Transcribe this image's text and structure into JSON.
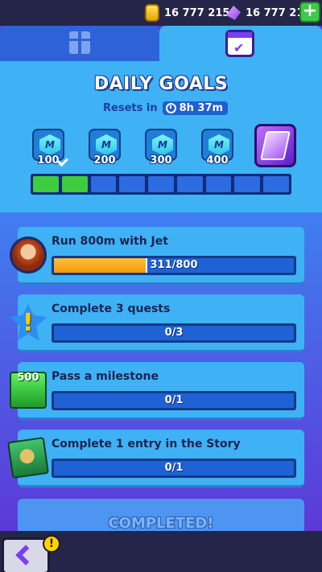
{
  "currency": {
    "coins": "16 777 215",
    "gems": "16 777 215",
    "add_label": "+"
  },
  "tabs": [
    {
      "name": "gifts",
      "icon": "gift-icon",
      "active": false
    },
    {
      "name": "daily-goals",
      "icon": "calendar-check-icon",
      "active": true
    }
  ],
  "header": {
    "title": "DAILY GOALS",
    "resets_label": "Resets in",
    "timer": "8h 37m",
    "milestones": [
      {
        "value": "100",
        "done": true,
        "icon_letter": "M"
      },
      {
        "value": "200",
        "done": false,
        "icon_letter": "M"
      },
      {
        "value": "300",
        "done": false,
        "icon_letter": "M"
      },
      {
        "value": "400",
        "done": false,
        "icon_letter": "M"
      }
    ],
    "progress_segments_total": 9,
    "progress_segments_done": 2
  },
  "goals": [
    {
      "title": "Run 800m with Jet",
      "progress_text": "311/800",
      "current": 311,
      "target": 800,
      "icon": "jet-character-icon"
    },
    {
      "title": "Complete 3 quests",
      "progress_text": "0/3",
      "current": 0,
      "target": 3,
      "icon": "quest-exclamation-icon"
    },
    {
      "title": "Pass a milestone",
      "progress_text": "0/1",
      "current": 0,
      "target": 1,
      "icon": "milestone-500-icon",
      "icon_label": "500"
    },
    {
      "title": "Complete 1 entry in the Story",
      "progress_text": "0/1",
      "current": 0,
      "target": 1,
      "icon": "story-book-icon"
    }
  ],
  "completed_label": "COMPLETED!",
  "bottom": {
    "alert_label": "!"
  },
  "colors": {
    "accent": "#3fb1f5",
    "progress_orange": "#f39a0a",
    "segment_done": "#3fcc3f"
  }
}
